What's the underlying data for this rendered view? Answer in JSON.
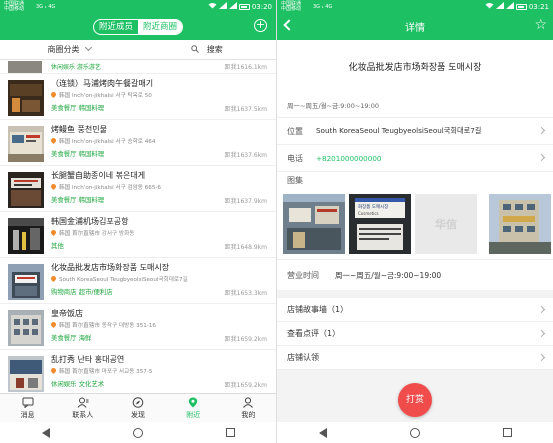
{
  "left_phone": {
    "status": {
      "carrier_1": "中国联通",
      "carrier_2": "中国移动",
      "signal": "3G ₁ 4G",
      "time": "03:20"
    },
    "header": {
      "tab_recommend": "附近成员",
      "tab_merchants": "附近商圈",
      "active_tab": "tab_merchants"
    },
    "filter": {
      "category": "商圈分类",
      "search": "搜索"
    },
    "top_strip": {
      "tag": "休闲娱乐 游乐游艺",
      "distance": "距我1616.1km"
    },
    "items": [
      {
        "name": "（连锁）马浦烤肉午餐갈매기",
        "address": "韩国 Inch'on-jikhalsi 서구 탁옥로 50",
        "tags": "美食餐厅 韩国料理",
        "distance": "距我1637.5km"
      },
      {
        "name": "烤鳗鱼 풍천민물",
        "address": "韩国 Inch'on-jikhalsi 서구 승학로 464",
        "tags": "美食餐厅 韩国料理",
        "distance": "距我1637.6km"
      },
      {
        "name": "长腿蟹自助종이네 볶은대게",
        "address": "韩国 Inch'on-jikhalsi 서구 검암동 665-6",
        "tags": "美食餐厅 韩国料理",
        "distance": "距我1637.9km"
      },
      {
        "name": "韩国金浦机场김포공항",
        "address": "韩国 首尔直辖市 강서구 방화동",
        "tags": "其他",
        "distance": "距我1648.9km"
      },
      {
        "name": "化妆品批发店市场화장품 도매시장",
        "address": "South KoreaSeoul TeugbyeolsiSeoul국회대로7길",
        "tags": "购物商店 超市/便利店",
        "distance": "距我1653.3km"
      },
      {
        "name": "皇帝饭店",
        "address": "韩国 首尔直辖市 동작구 대방동 351-16",
        "tags": "美食餐厅 海鲜",
        "distance": "距我1659.2km"
      },
      {
        "name": "乱打秀 난타 홍대공연",
        "address": "韩国 首尔直辖市 마포구 서교동 357-5",
        "tags": "休闲娱乐 文化艺术",
        "distance": "距我1659.2km"
      }
    ],
    "tabbar": [
      {
        "label": "消息",
        "icon": "message-icon"
      },
      {
        "label": "联系人",
        "icon": "contacts-icon"
      },
      {
        "label": "发现",
        "icon": "compass-icon"
      },
      {
        "label": "附近",
        "icon": "nearby-icon"
      },
      {
        "label": "我的",
        "icon": "profile-icon"
      }
    ],
    "active_tab_index": 3
  },
  "right_phone": {
    "status": {
      "carrier_1": "中国联通",
      "carrier_2": "中国移动",
      "signal": "3G ₁ 4G",
      "time": "03:21"
    },
    "header": {
      "title": "详情"
    },
    "shop_name": "化妆品批发店市场화장품 도매시장",
    "hours_short": "周一~周五/월~금:9:00~19:00",
    "location_label": "位置",
    "location_value": "South KoreaSeoul TeugbyeolsiSeoul국회대로7길",
    "phone_label": "电话",
    "phone_value": "+8201000000000",
    "gallery_label": "图集",
    "gallery_watermark": "华信",
    "sign_text_1": "화장품 도매시장",
    "sign_text_2": "Cosmetics",
    "hours_label": "营业时间",
    "hours_value": "周一~周五/월~금:9:00~19:00",
    "links": [
      {
        "label": "店铺故事墙（1）"
      },
      {
        "label": "查看点评（1）"
      },
      {
        "label": "店铺认领"
      }
    ],
    "tip_button": "打赏"
  },
  "colors": {
    "brand_green": "#1ec064",
    "tag_green": "#1ea63e",
    "tip_red": "#f04c4c",
    "pin_orange": "#f08a2a"
  }
}
